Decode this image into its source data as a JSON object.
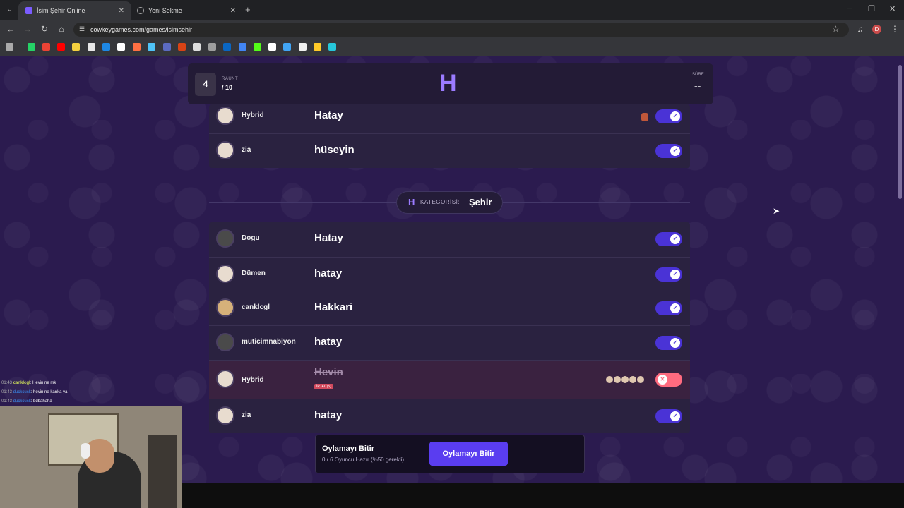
{
  "browser": {
    "tabs": [
      {
        "title": "İsim Şehir Online",
        "active": true
      },
      {
        "title": "Yeni Sekme",
        "active": false
      }
    ],
    "url": "cowkeygames.com/games/isimsehir",
    "profile_initial": "D"
  },
  "hud": {
    "round_current": "4",
    "round_label": "RAUNT",
    "round_total": "/ 10",
    "letter": "H",
    "time_label": "SÜRE",
    "time_value": "--"
  },
  "previous_category_rows": [
    {
      "player": "Hybrid",
      "answer": "Hatay",
      "accepted": true
    },
    {
      "player": "zia",
      "answer": "hüseyin",
      "accepted": true
    }
  ],
  "category": {
    "letter": "H",
    "label": "KATEGORİSİ:",
    "value": "Şehir"
  },
  "rows": [
    {
      "player": "Dogu",
      "answer": "Hatay",
      "accepted": true
    },
    {
      "player": "Dümen",
      "answer": "hatay",
      "accepted": true
    },
    {
      "player": "canklcgl",
      "answer": "Hakkari",
      "accepted": true
    },
    {
      "player": "muticimnabiyon",
      "answer": "hatay",
      "accepted": true
    },
    {
      "player": "Hybrid",
      "answer": "Hevin",
      "accepted": false,
      "cancel_tag": "İPTAL (5)"
    },
    {
      "player": "zia",
      "answer": "hatay",
      "accepted": true
    }
  ],
  "vote_bar": {
    "title": "Oylamayı Bitir",
    "subtitle": "0 / 6 Oyuncu Hazır (%50 gerekli)",
    "button": "Oylamayı Bitir"
  },
  "chat": [
    {
      "time": "01:43",
      "user": "canklcgl",
      "message": ": Hevin ne mk"
    },
    {
      "time": "01:43",
      "user": "duckcuck",
      "message": ": hevin ne kanka ya"
    },
    {
      "time": "01:43",
      "user": "duckcuck",
      "message": ": bdbahaha"
    }
  ],
  "colors": {
    "accent": "#5a3df0",
    "letter": "#9b7bff",
    "reject": "#ff6b7f",
    "page_bg": "#2b1b4f"
  }
}
